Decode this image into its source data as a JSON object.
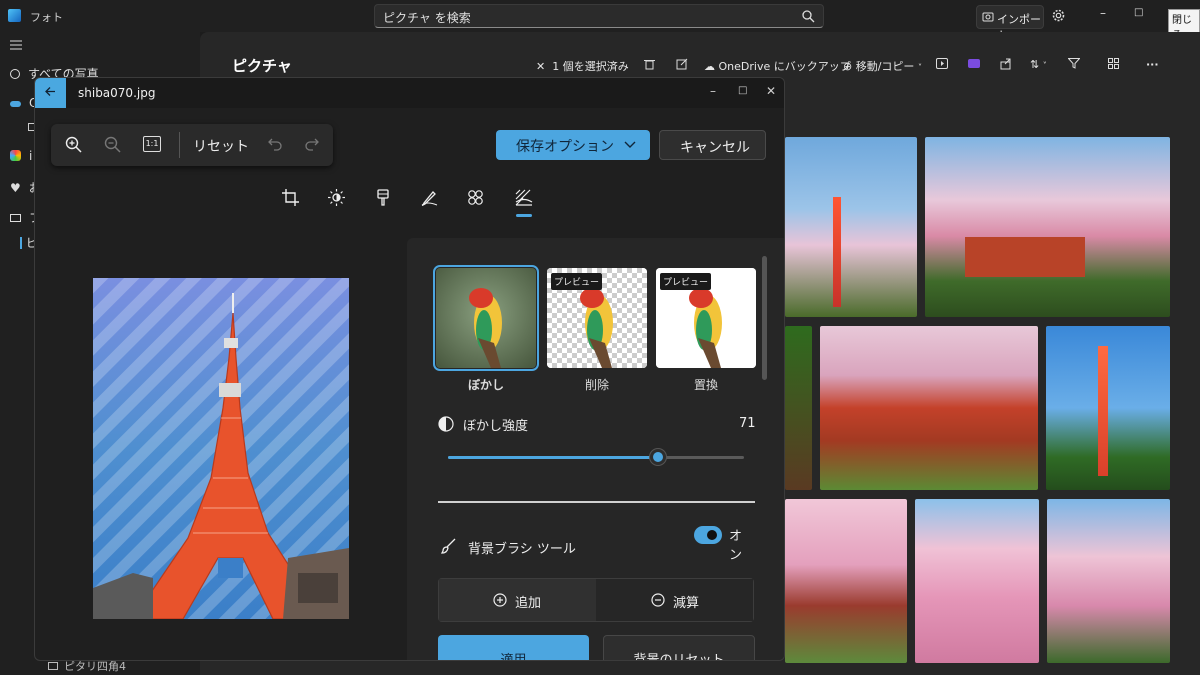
{
  "app": {
    "title": "フォト",
    "search_text": "ピクチャ を検索",
    "import_label": "インポート",
    "close_tooltip": "閉じる",
    "window_controls": [
      "–",
      "□",
      "✕"
    ]
  },
  "sidebar": {
    "items": [
      {
        "label": "すべての写真",
        "icon": "photos-icon"
      },
      {
        "label": "O",
        "icon": "onedrive-icon"
      },
      {
        "label": "",
        "icon": "gallery-icon"
      },
      {
        "label": "i",
        "icon": "icloud-icon"
      },
      {
        "label": "お",
        "icon": "heart-icon"
      },
      {
        "label": "フ",
        "icon": "folder-icon"
      },
      {
        "label": "ピ",
        "icon": "folder-icon"
      }
    ],
    "album_label": "ピタリ四角4"
  },
  "main": {
    "title": "ピクチャ",
    "commands": {
      "selection": "1 個を選択済み",
      "onedrive_backup": "OneDrive にバックアップ",
      "move_copy": "移動/コピー"
    }
  },
  "editor": {
    "filename": "shiba070.jpg",
    "reset_label": "リセット",
    "actual_size_label": "1:1",
    "save_label": "保存オプション",
    "cancel_label": "キャンセル",
    "tools": [
      "crop-icon",
      "brightness-icon",
      "filter-icon",
      "markup-icon",
      "retouch-icon",
      "background-icon"
    ],
    "active_tool": "background-icon",
    "modes": [
      {
        "label": "ぼかし",
        "selected": true,
        "tag": ""
      },
      {
        "label": "削除",
        "selected": false,
        "tag": "プレビュー"
      },
      {
        "label": "置換",
        "selected": false,
        "tag": "プレビュー"
      }
    ],
    "blur_strength_label": "ぼかし強度",
    "blur_strength_value": "71",
    "blur_strength_fraction": 0.71,
    "brush_tool_label": "背景ブラシ ツール",
    "brush_toggle_text": "オン",
    "brush_toggle_on": true,
    "add_label": "追加",
    "subtract_label": "減算",
    "apply_label": "適用",
    "reset_background_label": "背景のリセット"
  },
  "colors": {
    "accent": "#4ca6e0",
    "bg": "#1c1c1c",
    "panel": "#262626"
  }
}
